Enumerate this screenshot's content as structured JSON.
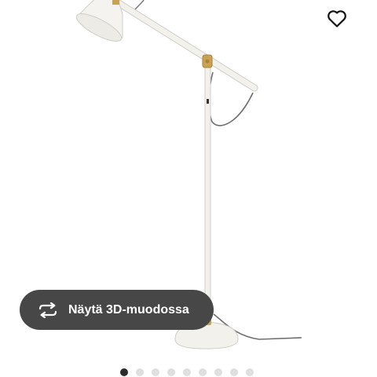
{
  "product": {
    "image_alt": "floor lamp"
  },
  "favourite": {
    "icon": "heart-icon"
  },
  "view_3d": {
    "label": "Näytä 3D-muodossa",
    "icon": "rotate-3d-icon"
  },
  "carousel": {
    "total_slides": 9,
    "active_index": 0
  },
  "colors": {
    "button_bg": "#474747",
    "dot_active": "#2b2b2b",
    "dot_inactive": "#dfdfdf",
    "lamp_body": "#f2f1ec",
    "brass": "#c9a253"
  }
}
